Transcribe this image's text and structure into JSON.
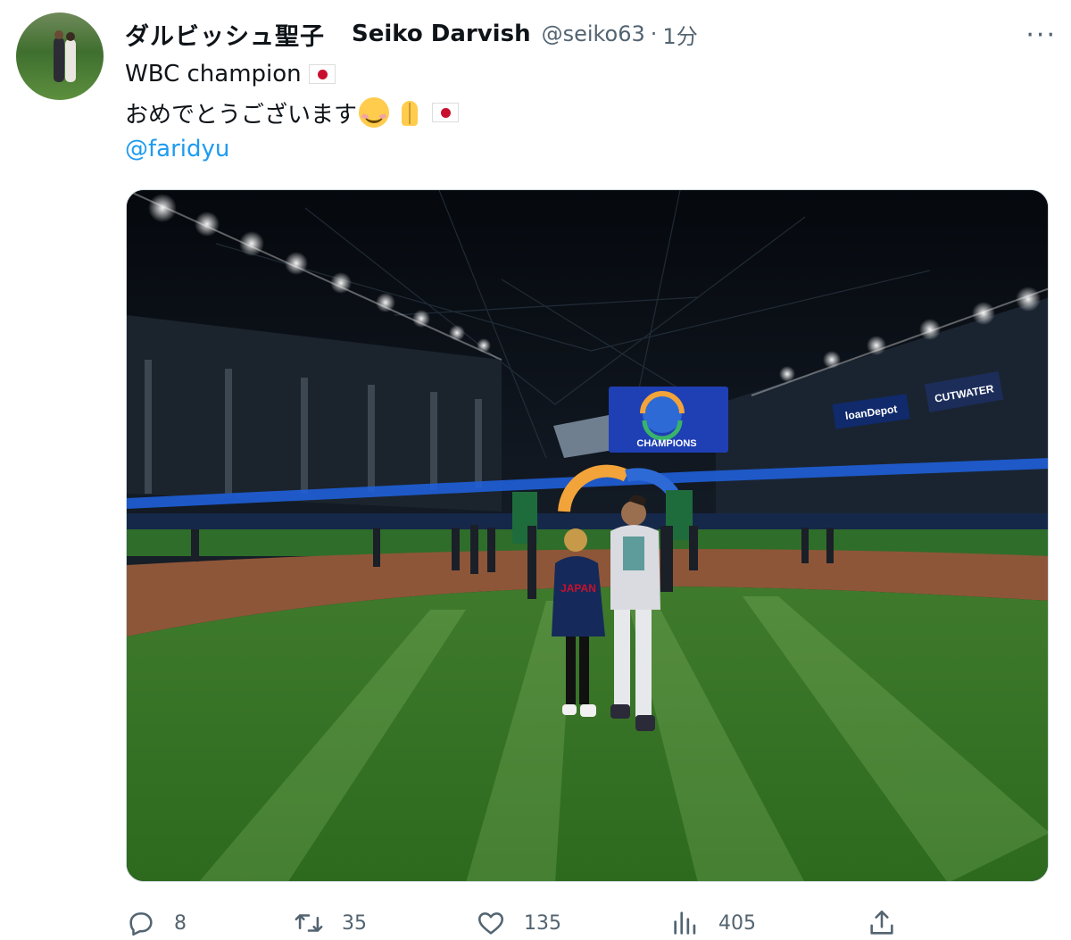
{
  "tweet": {
    "author_jp": "ダルビッシュ聖子",
    "author_en": "Seiko Darvish",
    "handle": "@seiko63",
    "separator": "·",
    "time": "1分",
    "more": "···",
    "line1": "WBC champion",
    "line2": "おめでとうございます",
    "mention": "@faridyu",
    "emojis": [
      "japan-flag",
      "smiling-face",
      "folded-hands",
      "japan-flag"
    ]
  },
  "photo": {
    "scoreboard_text": "CHAMPIONS",
    "banner_right": "CUTWATER",
    "banner_loan": "loanDepot",
    "jersey_text": "JAPAN"
  },
  "actions": {
    "replies": "8",
    "retweets": "35",
    "likes": "135",
    "views": "405"
  }
}
